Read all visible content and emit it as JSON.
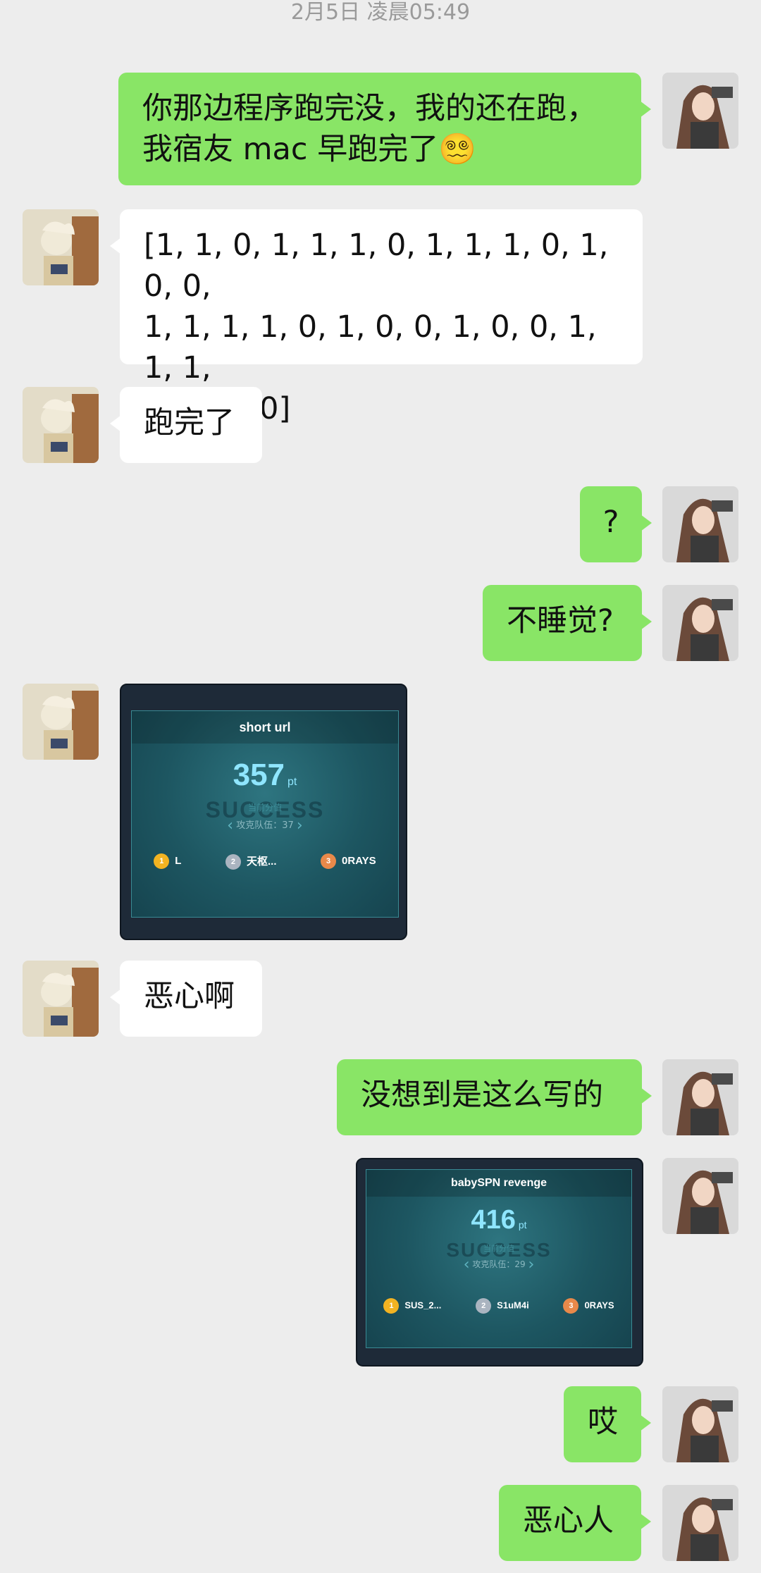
{
  "timestamp": "2月5日 凌晨05:49",
  "messages": [
    {
      "sender": "me",
      "text": "你那边程序跑完没，我的还在跑，\n我宿友 mac 早跑完了😵‍💫"
    },
    {
      "sender": "them",
      "text": "[1, 1, 0, 1, 1, 1, 0, 1, 1, 1, 0, 1, 0, 0,\n1, 1, 1, 1, 0, 1, 0, 0, 1, 0, 0, 1, 1, 1,\n0, 1, 1, 0]"
    },
    {
      "sender": "them",
      "text": "跑完了"
    },
    {
      "sender": "me",
      "text": "?"
    },
    {
      "sender": "me",
      "text": "不睡觉?"
    },
    {
      "sender": "them",
      "text": "恶心啊"
    },
    {
      "sender": "me",
      "text": "没想到是这么写的"
    },
    {
      "sender": "me",
      "text": "哎"
    },
    {
      "sender": "me",
      "text": "恶心人"
    }
  ],
  "cards": [
    {
      "sender": "them",
      "title": "short url",
      "score": "357",
      "unit": "pt",
      "sub": "当前分值",
      "watermark": "SUCCESS",
      "teams": "攻克队伍：37",
      "podium": [
        {
          "rank": "1",
          "name": "L"
        },
        {
          "rank": "2",
          "name": "天枢..."
        },
        {
          "rank": "3",
          "name": "0RAYS"
        }
      ]
    },
    {
      "sender": "me",
      "title": "babySPN revenge",
      "score": "416",
      "unit": "pt",
      "sub": "当前分值",
      "watermark": "SUCCESS",
      "teams": "攻克队伍：29",
      "podium": [
        {
          "rank": "1",
          "name": "SUS_2..."
        },
        {
          "rank": "2",
          "name": "S1uM4i"
        },
        {
          "rank": "3",
          "name": "0RAYS"
        }
      ]
    }
  ],
  "colors": {
    "me_bubble": "#89e566",
    "them_bubble": "#ffffff",
    "background": "#ededed"
  }
}
